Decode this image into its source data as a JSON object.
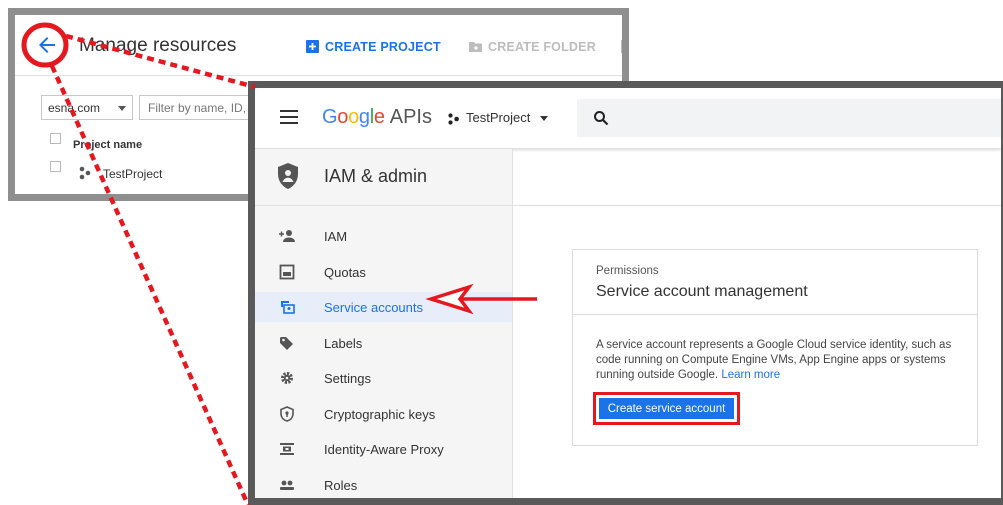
{
  "background_window": {
    "title": "Manage resources",
    "actions": [
      {
        "label": "CREATE PROJECT",
        "icon": "plus-box-icon",
        "color": "#1a73e8"
      },
      {
        "label": "CREATE FOLDER",
        "icon": "folder-plus-icon",
        "color": "#bdbdbd"
      }
    ],
    "org_select": "esna.com",
    "filter_placeholder": "Filter by name, ID, pro",
    "table": {
      "column_header": "Project name",
      "rows": [
        {
          "name": "TestProject",
          "icon": "project-dots-icon"
        }
      ]
    }
  },
  "foreground_window": {
    "brand": {
      "google": "Google",
      "apis": "APIs"
    },
    "project": {
      "name": "TestProject"
    },
    "search": {
      "icon": "search-icon"
    },
    "sidebar": {
      "title": "IAM & admin",
      "items": [
        {
          "label": "IAM",
          "icon": "person-add-icon"
        },
        {
          "label": "Quotas",
          "icon": "quota-icon"
        },
        {
          "label": "Service accounts",
          "icon": "service-account-icon",
          "active": true
        },
        {
          "label": "Labels",
          "icon": "label-icon"
        },
        {
          "label": "Settings",
          "icon": "gear-icon"
        },
        {
          "label": "Cryptographic keys",
          "icon": "key-shield-icon"
        },
        {
          "label": "Identity-Aware Proxy",
          "icon": "proxy-icon"
        },
        {
          "label": "Roles",
          "icon": "roles-icon"
        }
      ]
    },
    "card": {
      "eyebrow": "Permissions",
      "title": "Service account management",
      "description": "A service account represents a Google Cloud service identity, such as code running on Compute Engine VMs, App Engine apps or systems running outside Google.",
      "learn_more": "Learn more",
      "button": "Create service account"
    }
  },
  "colors": {
    "accent": "#1a73e8",
    "highlight_red": "#e5171f",
    "google_blue": "#4285f4",
    "google_red": "#ea4335",
    "google_yellow": "#fbbc05",
    "google_green": "#34a853"
  }
}
